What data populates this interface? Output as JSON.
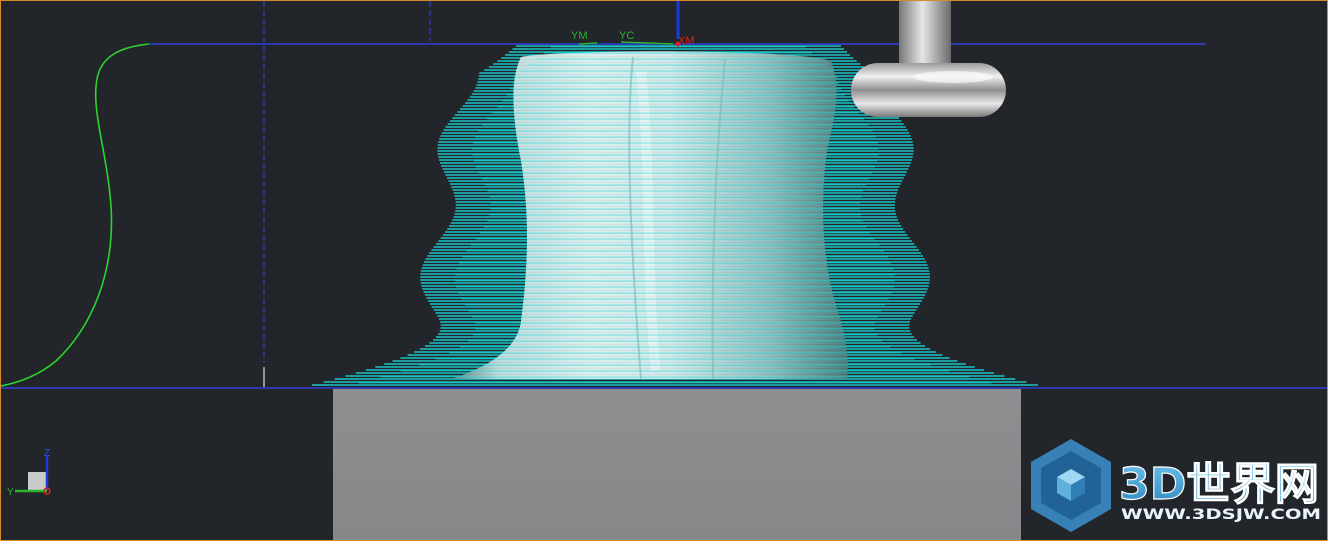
{
  "viewport": {
    "background": "#22252a",
    "border_color": "#d98a2b"
  },
  "coordinate_labels": {
    "ym": "YM",
    "yc": "YC",
    "xm": "XM"
  },
  "view_triad": {
    "z_label": "Z",
    "y_label": "Y"
  },
  "watermark": {
    "title": "3D世界网",
    "url": "WWW.3DSJW.COM",
    "logo_icon": "cube-hexagon-logo-icon"
  },
  "colors": {
    "toolpath": "#19e3e3",
    "boundary_line": "#2f3ed8",
    "profile_curve": "#2ad42a",
    "stock_block": "#8a8c8d",
    "part_surface": "#d8ecec",
    "tool": "#b8b8b8",
    "axis_x": "#e02020",
    "axis_y": "#2ab52a",
    "axis_z": "#1b3bd8"
  }
}
